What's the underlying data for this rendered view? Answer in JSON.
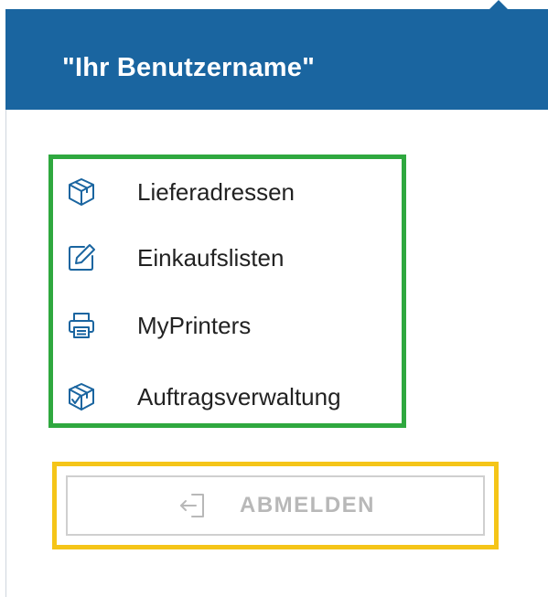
{
  "header": {
    "title": "\"Ihr Benutzername\""
  },
  "menu": {
    "items": [
      {
        "label": "Lieferadressen",
        "icon": "package-icon"
      },
      {
        "label": "Einkaufslisten",
        "icon": "edit-icon"
      },
      {
        "label": "MyPrinters",
        "icon": "printer-icon"
      },
      {
        "label": "Auftragsverwaltung",
        "icon": "package-check-icon"
      }
    ]
  },
  "logout": {
    "label": "ABMELDEN",
    "icon": "logout-icon"
  },
  "colors": {
    "header_bg": "#1a65a0",
    "icon_blue": "#1a65a0",
    "menu_highlight": "#2fa83f",
    "logout_highlight": "#f5c518",
    "logout_text": "#b8b8b8"
  }
}
